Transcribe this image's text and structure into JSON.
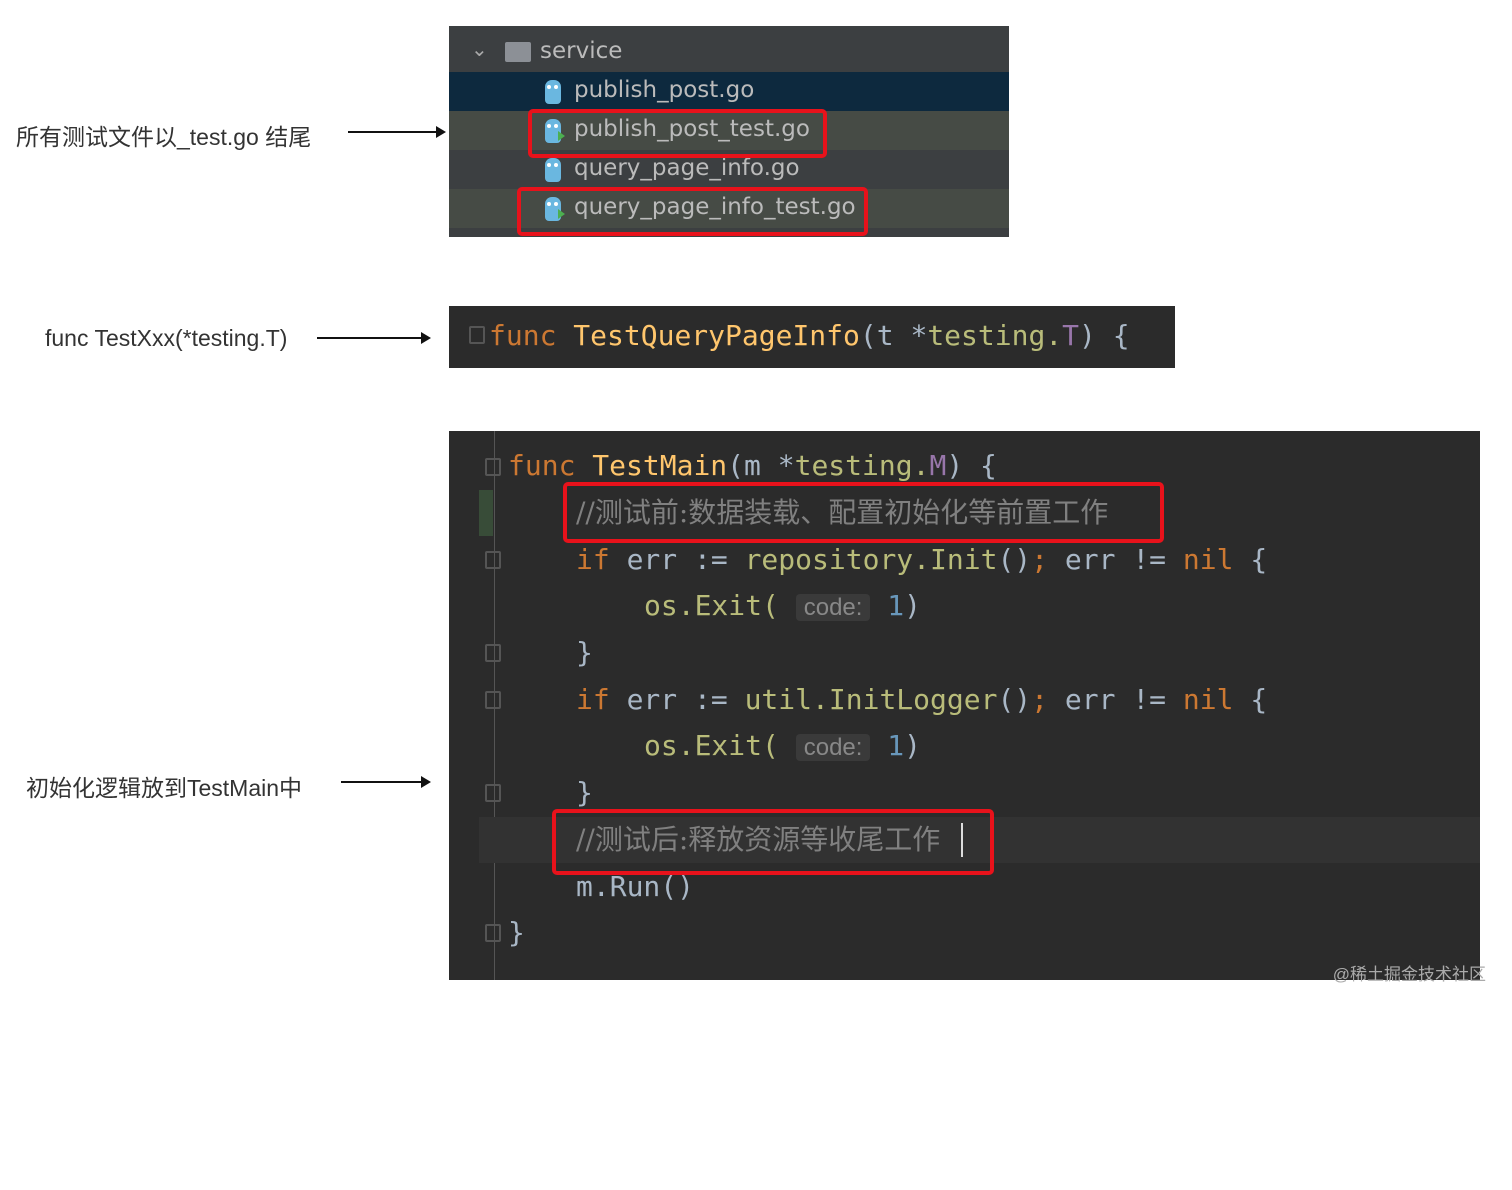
{
  "annotations": {
    "test_file_suffix": "所有测试文件以_test.go 结尾",
    "test_func_signature": "func TestXxx(*testing.T)",
    "testmain_init": "初始化逻辑放到TestMain中"
  },
  "file_tree": {
    "folder": "service",
    "files": [
      "publish_post.go",
      "publish_post_test.go",
      "query_page_info.go",
      "query_page_info_test.go"
    ]
  },
  "test_func": {
    "kw": "func",
    "name": "TestQueryPageInfo",
    "open": "(t *",
    "type": "testing.",
    "typeT": "T",
    "close": ") {"
  },
  "testmain": {
    "l1": {
      "kw": "func",
      "name": "TestMain",
      "p1": "(m *",
      "type": "testing.",
      "typeM": "M",
      "p2": ") {"
    },
    "comment_before": "//测试前:数据装载、配置初始化等前置工作",
    "l3": {
      "kw": "if",
      "a": " err := ",
      "pkg": "repository.Init",
      "b": "()",
      "semi": ";",
      "c": " err != ",
      "nil": "nil",
      "d": " {"
    },
    "exit": {
      "call": "os.Exit(",
      "hint": "code:",
      "num": "1",
      "close": ")"
    },
    "brace": "}",
    "l6": {
      "kw": "if",
      "a": " err := ",
      "pkg": "util.InitLogger",
      "b": "()",
      "semi": ";",
      "c": " err != ",
      "nil": "nil",
      "d": " {"
    },
    "comment_after": "//测试后:释放资源等收尾工作",
    "run": "m.Run()",
    "end": "}"
  },
  "watermark": "@稀土掘金技术社区"
}
